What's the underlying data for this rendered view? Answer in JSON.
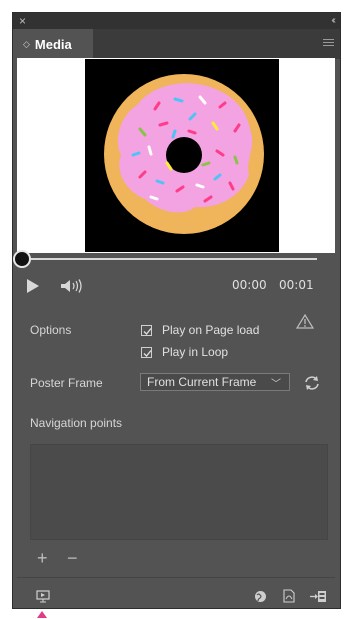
{
  "panel": {
    "close_glyph": "×",
    "collapse_glyph": "‹‹",
    "tab_title": "Media"
  },
  "preview": {
    "image": "donut-image",
    "background": "#000000"
  },
  "transport": {
    "current_time": "00:00",
    "duration": "00:01",
    "scrub_progress": 0
  },
  "options": {
    "label": "Options",
    "play_on_page_load": {
      "label": "Play on Page load",
      "checked": true
    },
    "play_in_loop": {
      "label": "Play in Loop",
      "checked": true
    }
  },
  "poster_frame": {
    "label": "Poster Frame",
    "selected": "From Current Frame"
  },
  "navigation_points": {
    "label": "Navigation points",
    "items": []
  },
  "buttons": {
    "add": "+",
    "remove": "−"
  },
  "colors": {
    "panel_bg": "#535353",
    "donut_dough": "#f0b45a",
    "frosting": "#f3a2e2",
    "accent_pink": "#e03c87"
  }
}
